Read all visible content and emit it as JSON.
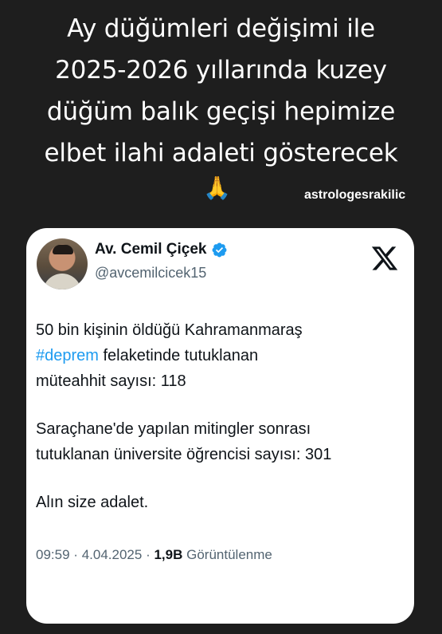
{
  "caption": {
    "lines": [
      "Ay düğümleri değişimi ile",
      "2025-2026 yıllarında kuzey",
      "düğüm balık geçişi hepimize",
      "elbet ilahi adaleti gösterecek"
    ],
    "emoji": "🙏"
  },
  "watermark": "astrologesrakilic",
  "tweet": {
    "author_name": "Av. Cemil Çiçek",
    "handle": "@avcemilcicek15",
    "para1": {
      "line1": "50 bin kişinin öldüğü Kahramanmaraş",
      "hashtag": "#deprem",
      "line2_rest": " felaketinde tutuklanan",
      "line3": "müteahhit sayısı: 118"
    },
    "para2": {
      "line1": "Saraçhane'de yapılan mitingler sonrası",
      "line2": "tutuklanan üniversite öğrencisi sayısı: 301"
    },
    "para3": "Alın size adalet.",
    "time": "09:59",
    "date": "4.04.2025",
    "views_count": "1,9B",
    "views_label": "Görüntülenme",
    "separator": "·"
  },
  "colors": {
    "background": "#1e1e1e",
    "hashtag": "#1d9bf0",
    "verified": "#1d9bf0",
    "muted": "#536471"
  },
  "icons": [
    "verified-badge-icon",
    "x-logo-icon",
    "folded-hands-emoji"
  ]
}
